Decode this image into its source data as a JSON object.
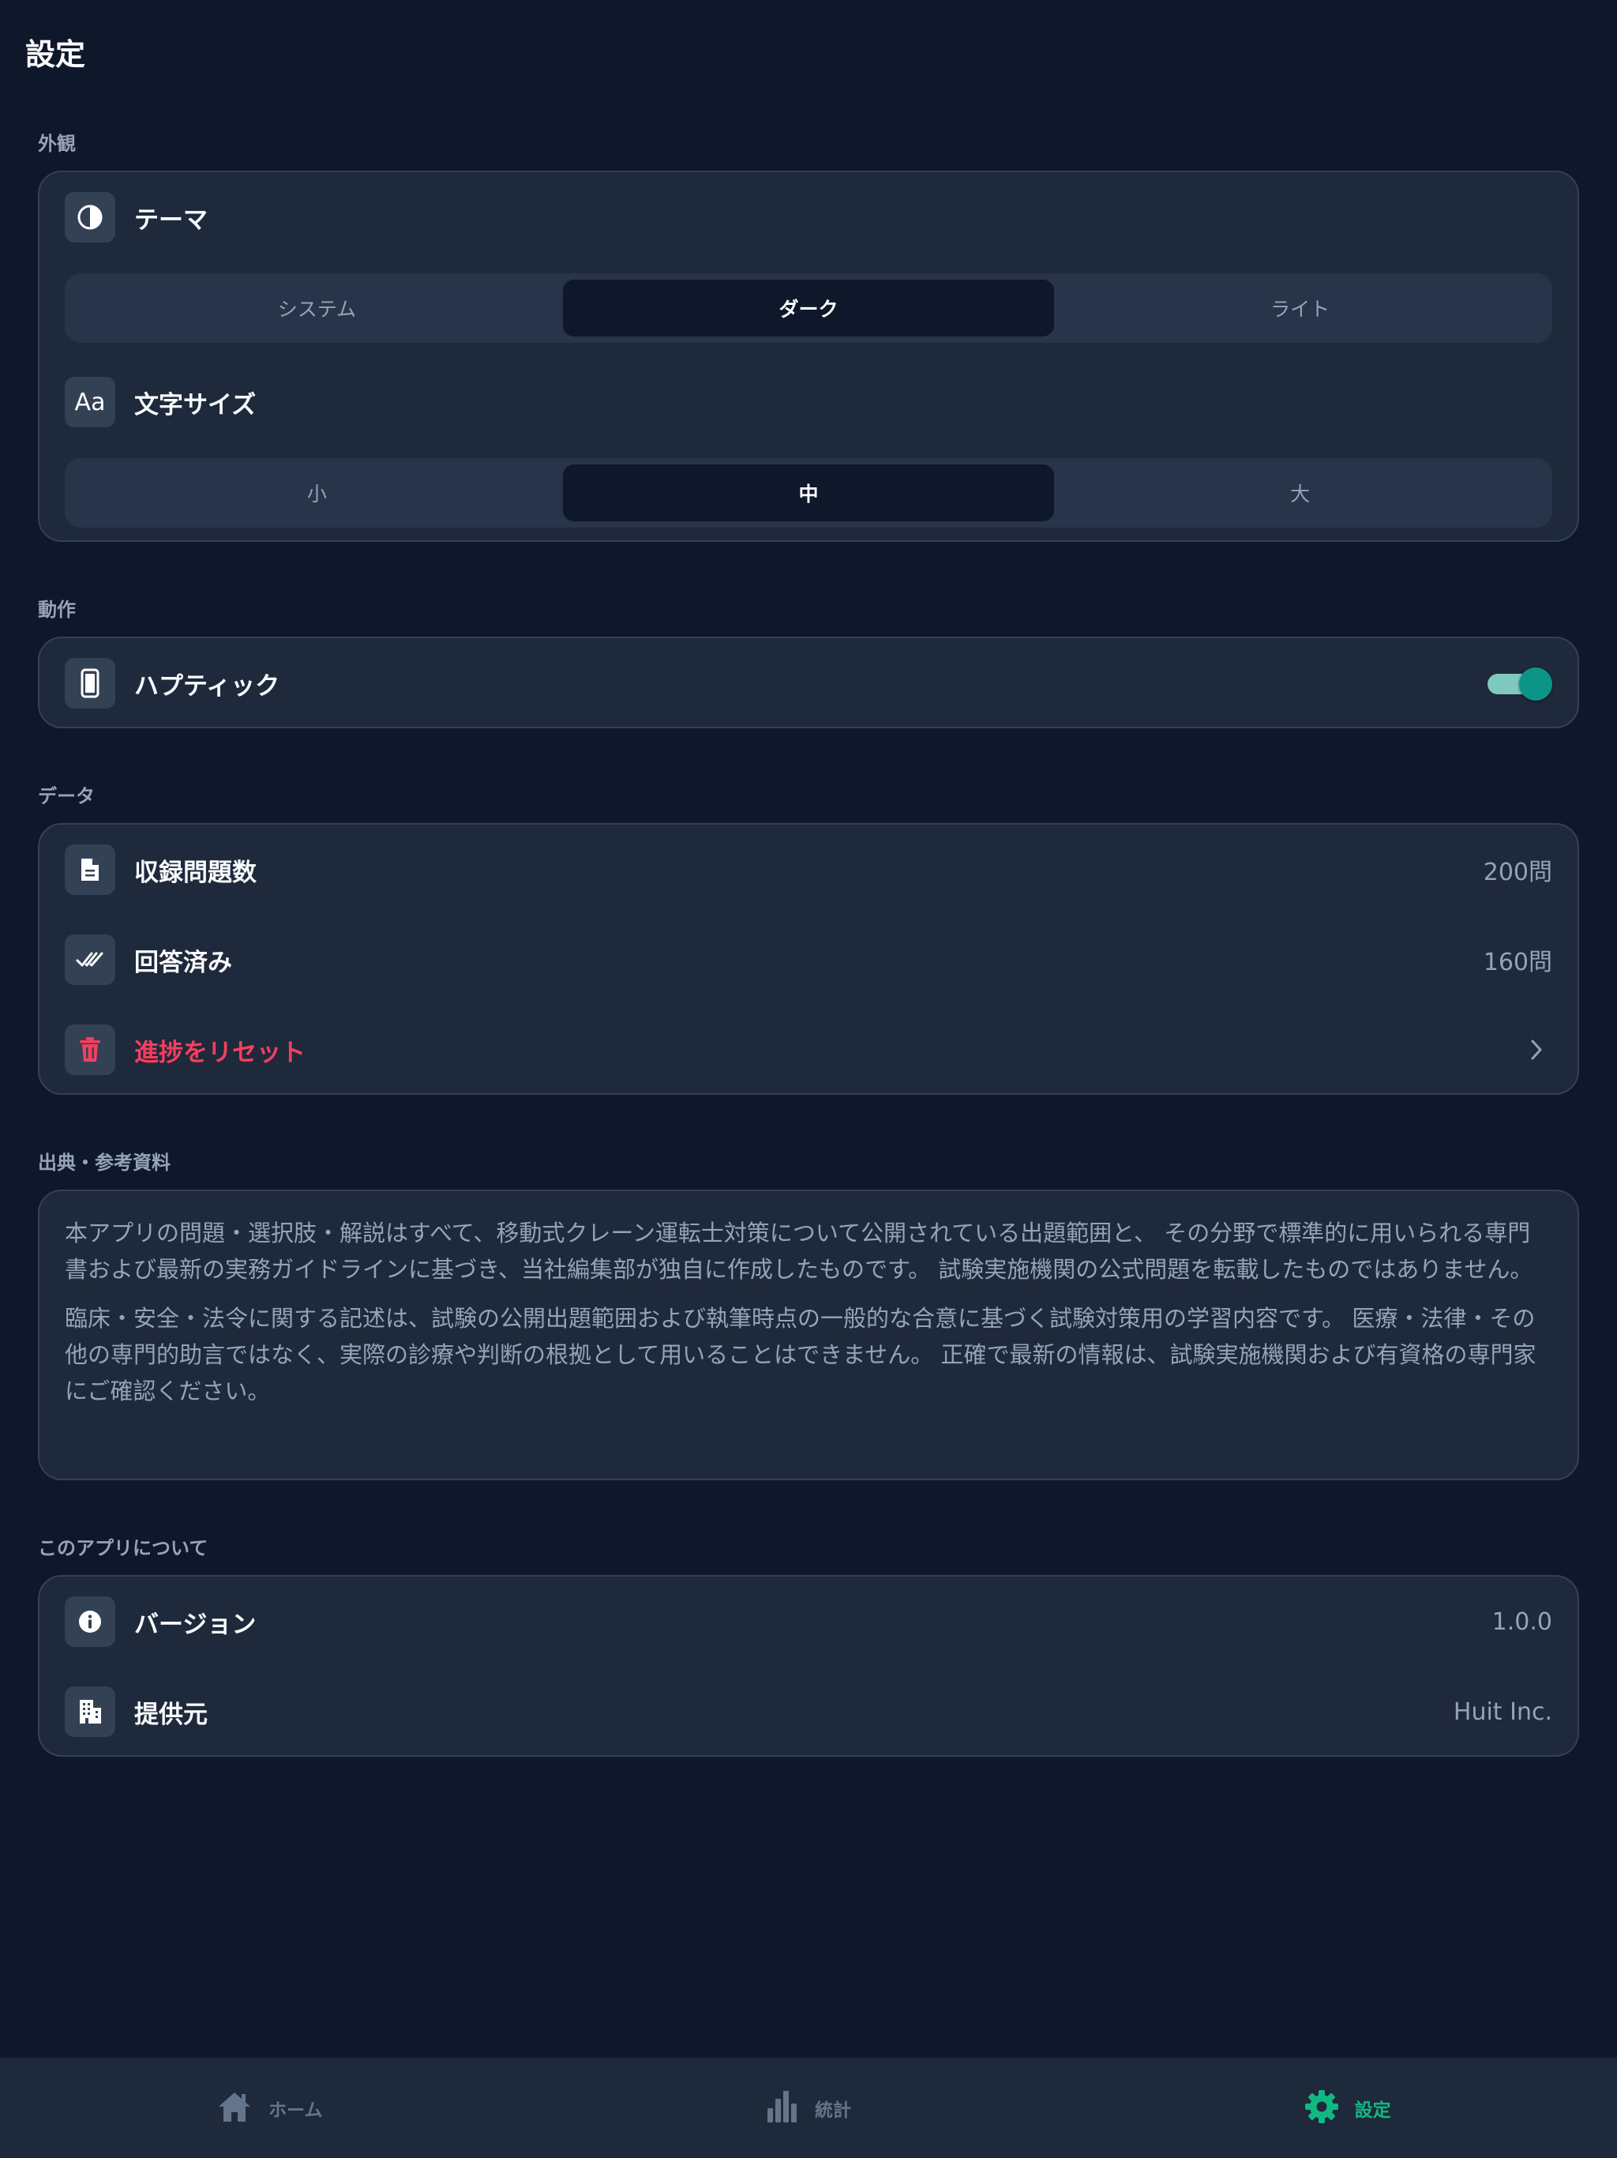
{
  "header": {
    "title": "設定"
  },
  "appearance": {
    "section_label": "外観",
    "theme": {
      "label": "テーマ",
      "icon": "contrast-icon",
      "options": [
        "システム",
        "ダーク",
        "ライト"
      ],
      "selected": "ダーク"
    },
    "font_size": {
      "label": "文字サイズ",
      "icon": "text-size-icon",
      "icon_text": "Aa",
      "options": [
        "小",
        "中",
        "大"
      ],
      "selected": "中"
    }
  },
  "behavior": {
    "section_label": "動作",
    "haptic": {
      "label": "ハプティック",
      "icon": "phone-icon",
      "enabled": true
    }
  },
  "data": {
    "section_label": "データ",
    "question_count": {
      "label": "収録問題数",
      "value": "200問",
      "icon": "document-icon"
    },
    "answered": {
      "label": "回答済み",
      "value": "160問",
      "icon": "double-check-icon"
    },
    "reset": {
      "label": "進捗をリセット",
      "icon": "trash-icon"
    }
  },
  "sources": {
    "section_label": "出典・参考資料",
    "paragraph1": "本アプリの問題・選択肢・解説はすべて、移動式クレーン運転士対策について公開されている出題範囲と、 その分野で標準的に用いられる専門書および最新の実務ガイドラインに基づき、当社編集部が独自に作成したものです。 試験実施機関の公式問題を転載したものではありません。",
    "paragraph2": "臨床・安全・法令に関する記述は、試験の公開出題範囲および執筆時点の一般的な合意に基づく試験対策用の学習内容です。 医療・法律・その他の専門的助言ではなく、実際の診療や判断の根拠として用いることはできません。 正確で最新の情報は、試験実施機関および有資格の専門家にご確認ください。"
  },
  "about": {
    "section_label": "このアプリについて",
    "version": {
      "label": "バージョン",
      "value": "1.0.0",
      "icon": "info-icon"
    },
    "provider": {
      "label": "提供元",
      "value": "Huit Inc.",
      "icon": "building-icon"
    }
  },
  "tabbar": {
    "tabs": [
      {
        "label": "ホーム",
        "icon": "home-icon",
        "active": false
      },
      {
        "label": "統計",
        "icon": "bar-chart-icon",
        "active": false
      },
      {
        "label": "設定",
        "icon": "gear-icon",
        "active": true
      }
    ]
  },
  "colors": {
    "background": "#0f172a",
    "card": "#1e293b",
    "accent": "#10b981",
    "toggle_on": "#0d9488",
    "danger": "#f43f5e",
    "muted_text": "#94a3b8"
  }
}
